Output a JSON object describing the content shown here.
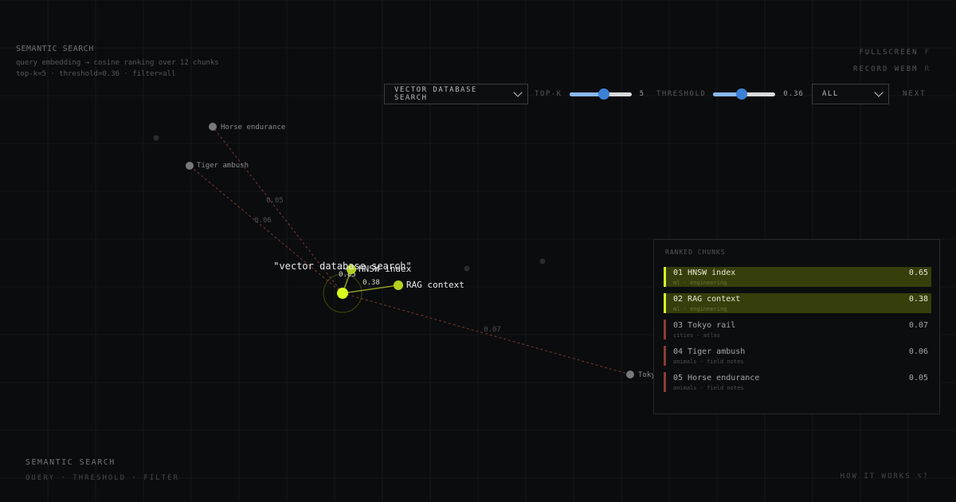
{
  "header": {
    "title": "SEMANTIC SEARCH",
    "line1": "query embedding → cosine ranking over 12 chunks",
    "line2": "top-k=5 · threshold=0.36 · filter=all"
  },
  "top_right": {
    "fullscreen_label": "FULLSCREEN",
    "fullscreen_key": "F",
    "record_label": "RECORD WEBM",
    "record_key": "R"
  },
  "controls": {
    "query_select": "VECTOR DATABASE SEARCH",
    "topk_label": "TOP-K",
    "topk_value": "5",
    "topk_fraction": 0.56,
    "threshold_label": "THRESHOLD",
    "threshold_value": "0.36",
    "threshold_fraction": 0.46,
    "filter_select": "ALL",
    "next_label": "NEXT"
  },
  "scene": {
    "query_text": "\"vector database search\"",
    "accent": "#d8ff1f",
    "dim_node": "#77797c",
    "hit_link": "#9aa82a",
    "miss_link": "#a04848",
    "nodes": [
      {
        "label": "HNSW index",
        "score": "0.65",
        "hit": true
      },
      {
        "label": "RAG context",
        "score": "0.38",
        "hit": true
      },
      {
        "label": "Tokyo rail",
        "score": "0.07",
        "hit": false
      },
      {
        "label": "Tiger ambush",
        "score": "0.06",
        "hit": false
      },
      {
        "label": "Horse endurance",
        "score": "0.05",
        "hit": false
      }
    ]
  },
  "ranked": {
    "title": "RANKED CHUNKS",
    "items": [
      {
        "name": "01 HNSW index",
        "sub": "ml · engineering",
        "score": "0.65",
        "selected": true,
        "bar": "#d8ff1f"
      },
      {
        "name": "02 RAG context",
        "sub": "ml · engineering",
        "score": "0.38",
        "selected": true,
        "bar": "#d8ff1f"
      },
      {
        "name": "03 Tokyo rail",
        "sub": "cities · atlas",
        "score": "0.07",
        "selected": false,
        "bar": "#8a3b35"
      },
      {
        "name": "04 Tiger ambush",
        "sub": "animals · field notes",
        "score": "0.06",
        "selected": false,
        "bar": "#8a3b35"
      },
      {
        "name": "05 Horse endurance",
        "sub": "animals · field notes",
        "score": "0.05",
        "selected": false,
        "bar": "#8a3b35"
      }
    ]
  },
  "footer": {
    "title": "SEMANTIC SEARCH",
    "subtitle": "QUERY · THRESHOLD · FILTER",
    "help": "HOW IT WORKS ⌥?"
  }
}
